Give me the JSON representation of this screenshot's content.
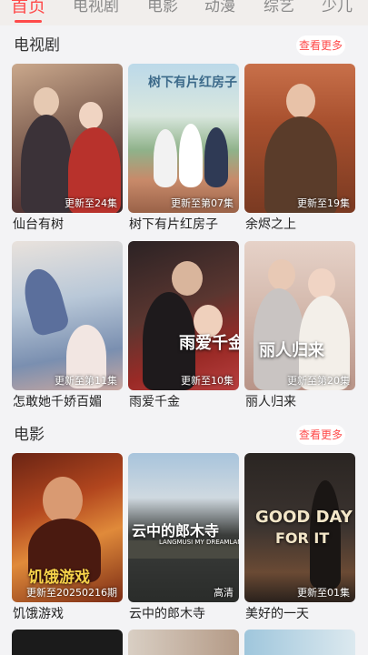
{
  "tabs": [
    {
      "label": "首页",
      "active": true
    },
    {
      "label": "电视剧",
      "active": false
    },
    {
      "label": "电影",
      "active": false
    },
    {
      "label": "动漫",
      "active": false
    },
    {
      "label": "综艺",
      "active": false
    },
    {
      "label": "少儿",
      "active": false
    }
  ],
  "accent_color": "#ff4a4a",
  "tv_section": {
    "title": "电视剧",
    "more_label": "查看更多",
    "items": [
      {
        "title": "仙台有树",
        "badge": "更新至24集"
      },
      {
        "title": "树下有片红房子",
        "badge": "更新至第07集",
        "cover_text": "树下有片红房子"
      },
      {
        "title": "余烬之上",
        "badge": "更新至19集"
      },
      {
        "title": "怎敢她千娇百媚",
        "badge": "更新至第11集"
      },
      {
        "title": "雨爱千金",
        "badge": "更新至10集",
        "cover_text": "雨爱千金"
      },
      {
        "title": "丽人归来",
        "badge": "更新至第20集",
        "cover_text": "丽人归来"
      }
    ]
  },
  "movie_section": {
    "title": "电影",
    "more_label": "查看更多",
    "items": [
      {
        "title": "饥饿游戏",
        "badge": "更新至20250216期",
        "cover_text": "饥饿游戏"
      },
      {
        "title": "云中的郎木寺",
        "badge": "高清",
        "cover_text": "云中的郎木寺",
        "cover_subtext": "LANGMUSI MY DREAMLAND"
      },
      {
        "title": "美好的一天",
        "badge": "更新至01集",
        "cover_text_line1": "GOOD DAY",
        "cover_text_line2": "FOR IT"
      }
    ]
  }
}
